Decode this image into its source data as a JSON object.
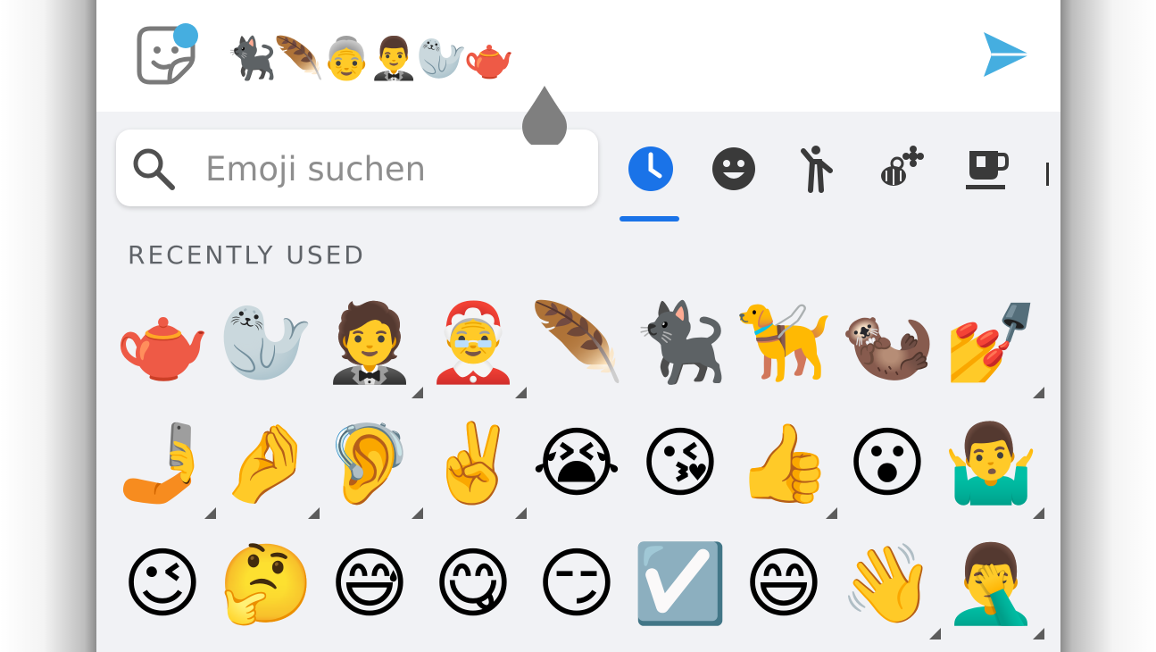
{
  "compose": {
    "sticker_icon": "sticker-smiley-icon",
    "sticker_badge_color": "#45aee0",
    "message_text": "🐈‍⬛🪶👵🤵‍♂️🦭🫖",
    "send_icon": "send-icon",
    "send_color": "#45aee0"
  },
  "search": {
    "placeholder": "Emoji suchen",
    "icon": "search-icon"
  },
  "categories": [
    {
      "name": "recent",
      "icon": "clock-icon",
      "active": true
    },
    {
      "name": "smileys",
      "icon": "smiley-face-icon",
      "active": false
    },
    {
      "name": "people",
      "icon": "person-icon",
      "active": false
    },
    {
      "name": "nature",
      "icon": "flower-bee-icon",
      "active": false
    },
    {
      "name": "food",
      "icon": "cup-icon",
      "active": false
    }
  ],
  "accent_color": "#1a73e8",
  "section": {
    "title": "RECENTLY USED"
  },
  "emoji_rows": [
    [
      {
        "char": "🫖",
        "has_variants": false
      },
      {
        "char": "🦭",
        "has_variants": false
      },
      {
        "char": "🤵",
        "has_variants": true
      },
      {
        "char": "🤶",
        "has_variants": true
      },
      {
        "char": "🪶",
        "has_variants": false
      },
      {
        "char": "🐈‍⬛",
        "has_variants": false
      },
      {
        "char": "🦮",
        "has_variants": false
      },
      {
        "char": "🦦",
        "has_variants": false
      },
      {
        "char": "💅",
        "has_variants": true
      }
    ],
    [
      {
        "char": "🤳",
        "has_variants": true
      },
      {
        "char": "🤌",
        "has_variants": true
      },
      {
        "char": "🦻",
        "has_variants": true
      },
      {
        "char": "✌️",
        "has_variants": true
      },
      {
        "char": "😭",
        "has_variants": false
      },
      {
        "char": "😘",
        "has_variants": false
      },
      {
        "char": "👍",
        "has_variants": true
      },
      {
        "char": "😮",
        "has_variants": false
      },
      {
        "char": "🤷‍♂️",
        "has_variants": true
      }
    ],
    [
      {
        "char": "😉",
        "has_variants": false
      },
      {
        "char": "🤔",
        "has_variants": false
      },
      {
        "char": "😅",
        "has_variants": false
      },
      {
        "char": "😋",
        "has_variants": false
      },
      {
        "char": "😏",
        "has_variants": false
      },
      {
        "char": "☑️",
        "has_variants": false
      },
      {
        "char": "😄",
        "has_variants": false
      },
      {
        "char": "👋",
        "has_variants": true
      },
      {
        "char": "🤦‍♂️",
        "has_variants": true
      }
    ]
  ]
}
